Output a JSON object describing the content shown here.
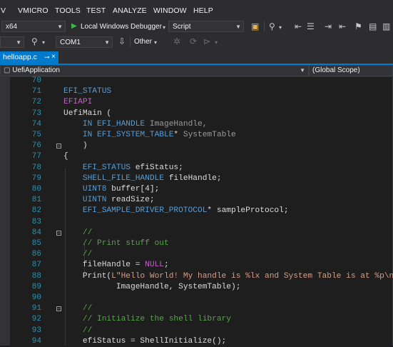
{
  "menu": [
    "V",
    "VMICRO",
    "TOOLS",
    "TEST",
    "ANALYZE",
    "WINDOW",
    "HELP"
  ],
  "toolbar": {
    "platform": "x64",
    "debugger_label": "Local Windows Debugger",
    "script_combo": "Script",
    "port_combo": "COM1",
    "other_label": "Other"
  },
  "tab": {
    "label": "helloapp.c",
    "pin": "⊸",
    "close": "×"
  },
  "nav": {
    "scope_left": "UefiApplication",
    "scope_right": "(Global Scope)"
  },
  "colors": {
    "accent": "#007acc",
    "keyword": "#569cd6",
    "type": "#4ec9b0",
    "macro": "#bd63c5",
    "comment": "#57a64a",
    "string": "#d69d85",
    "linenum": "#2b91af"
  },
  "code": [
    {
      "n": "70",
      "tokens": []
    },
    {
      "n": "71",
      "tokens": [
        {
          "t": "EFI_STATUS",
          "c": "kw"
        }
      ]
    },
    {
      "n": "72",
      "tokens": [
        {
          "t": "EFIAPI",
          "c": "mac"
        }
      ]
    },
    {
      "n": "73",
      "tokens": [
        {
          "t": "UefiMain (",
          "c": "txt"
        }
      ]
    },
    {
      "n": "74",
      "tokens": [
        {
          "t": "    IN ",
          "c": "kw"
        },
        {
          "t": "EFI_HANDLE",
          "c": "kw"
        },
        {
          "t": " ImageHandle,",
          "c": "par"
        }
      ]
    },
    {
      "n": "75",
      "tokens": [
        {
          "t": "    IN ",
          "c": "kw"
        },
        {
          "t": "EFI_SYSTEM_TABLE",
          "c": "kw"
        },
        {
          "t": "* ",
          "c": "txt"
        },
        {
          "t": "SystemTable",
          "c": "par"
        }
      ]
    },
    {
      "n": "76",
      "tokens": [
        {
          "t": "    )",
          "c": "txt"
        }
      ],
      "fold": "⊟"
    },
    {
      "n": "77",
      "tokens": [
        {
          "t": "{",
          "c": "txt"
        }
      ]
    },
    {
      "n": "78",
      "tokens": [
        {
          "t": "    EFI_STATUS",
          "c": "kw"
        },
        {
          "t": " efiStatus;",
          "c": "txt"
        }
      ]
    },
    {
      "n": "79",
      "tokens": [
        {
          "t": "    SHELL_FILE_HANDLE",
          "c": "kw"
        },
        {
          "t": " fileHandle;",
          "c": "txt"
        }
      ]
    },
    {
      "n": "80",
      "tokens": [
        {
          "t": "    UINT8",
          "c": "kw"
        },
        {
          "t": " buffer[4];",
          "c": "txt"
        }
      ]
    },
    {
      "n": "81",
      "tokens": [
        {
          "t": "    UINTN",
          "c": "kw"
        },
        {
          "t": " readSize;",
          "c": "txt"
        }
      ]
    },
    {
      "n": "82",
      "tokens": [
        {
          "t": "    EFI_SAMPLE_DRIVER_PROTOCOL",
          "c": "kw"
        },
        {
          "t": "* sampleProtocol;",
          "c": "txt"
        }
      ]
    },
    {
      "n": "83",
      "tokens": []
    },
    {
      "n": "84",
      "tokens": [
        {
          "t": "    //",
          "c": "cm"
        }
      ],
      "fold": "⊟"
    },
    {
      "n": "85",
      "tokens": [
        {
          "t": "    // Print stuff out",
          "c": "cm"
        }
      ]
    },
    {
      "n": "86",
      "tokens": [
        {
          "t": "    //",
          "c": "cm"
        }
      ]
    },
    {
      "n": "87",
      "tokens": [
        {
          "t": "    fileHandle = ",
          "c": "txt"
        },
        {
          "t": "NULL",
          "c": "mac"
        },
        {
          "t": ";",
          "c": "txt"
        }
      ]
    },
    {
      "n": "88",
      "tokens": [
        {
          "t": "    Print(",
          "c": "txt"
        },
        {
          "t": "L\"Hello World! My handle is %lx and System Table is at %p\\n\"",
          "c": "str"
        },
        {
          "t": ",",
          "c": "txt"
        }
      ]
    },
    {
      "n": "89",
      "tokens": [
        {
          "t": "           ImageHandle, SystemTable);",
          "c": "txt"
        }
      ]
    },
    {
      "n": "90",
      "tokens": []
    },
    {
      "n": "91",
      "tokens": [
        {
          "t": "    //",
          "c": "cm"
        }
      ],
      "fold": "⊟"
    },
    {
      "n": "92",
      "tokens": [
        {
          "t": "    // Initialize the shell library",
          "c": "cm"
        }
      ]
    },
    {
      "n": "93",
      "tokens": [
        {
          "t": "    //",
          "c": "cm"
        }
      ]
    },
    {
      "n": "94",
      "tokens": [
        {
          "t": "    efiStatus = ShellInitialize();",
          "c": "txt"
        }
      ]
    }
  ]
}
